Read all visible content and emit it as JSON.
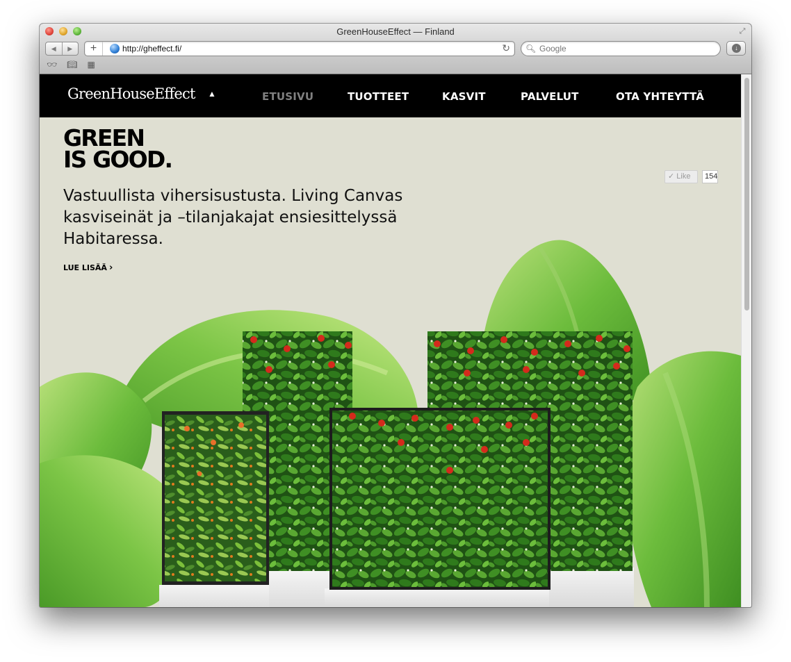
{
  "browser": {
    "window_title": "GreenHouseEffect — Finland",
    "url": "http://gheffect.fi/",
    "search_placeholder": "Google",
    "new_tab_label": "+"
  },
  "site": {
    "logo": "GreenHouseEffect",
    "nav": [
      "ETUSIVU",
      "TUOTTEET",
      "KASVIT",
      "PALVELUT",
      "OTA YHTEYTTÄ"
    ],
    "active_nav": "ETUSIVU"
  },
  "hero": {
    "title_line1": "GREEN",
    "title_line2": "IS GOOD.",
    "text": "Vastuullista vihersisustusta. Living Canvas kasviseinät ja –tilanjakajat ensiesittelyssä Habitaressa.",
    "link": "LUE LISÄÄ"
  },
  "social": {
    "like_label": "Like",
    "like_count": "154"
  },
  "colors": {
    "page_bg": "#dfdfd2",
    "nav_bg": "#000000",
    "nav_active": "#808080",
    "leaf_green": "#5aa832",
    "flower_red": "#d42a1c"
  }
}
